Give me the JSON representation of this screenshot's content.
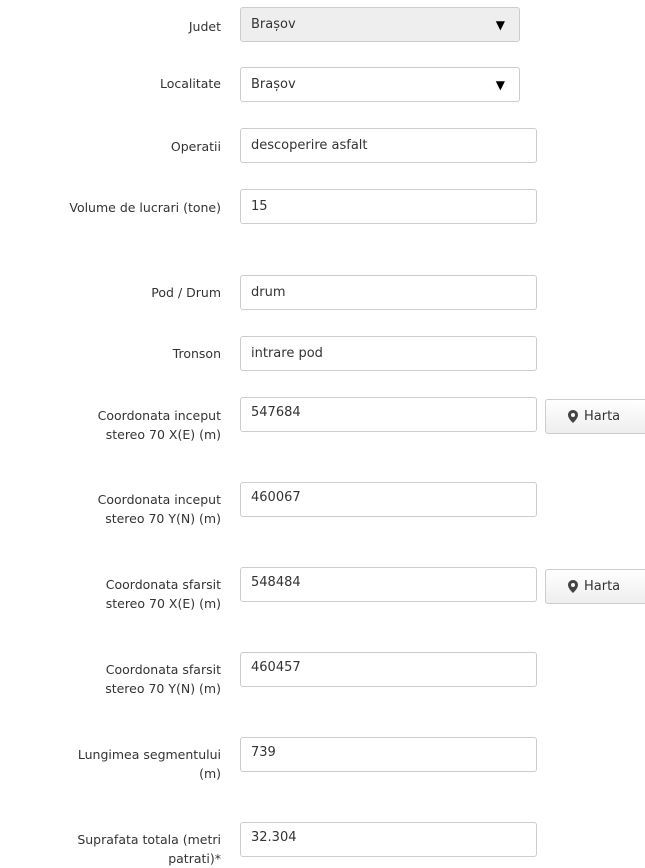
{
  "fields": {
    "judet": {
      "label": "Judet",
      "value": "Brașov"
    },
    "localitate": {
      "label": "Localitate",
      "value": "Brașov"
    },
    "operatii": {
      "label": "Operatii",
      "value": "descoperire asfalt"
    },
    "volume": {
      "label": "Volume de lucrari (tone)",
      "value": "15"
    },
    "pod_drum": {
      "label": "Pod / Drum",
      "value": "drum"
    },
    "tronson": {
      "label": "Tronson",
      "value": "intrare pod"
    },
    "inceput_x": {
      "label_line1": "Coordonata inceput",
      "label_line2": "stereo 70 X(E) (m)",
      "value": "547684"
    },
    "inceput_y": {
      "label_line1": "Coordonata inceput",
      "label_line2": "stereo 70 Y(N) (m)",
      "value": "460067"
    },
    "sfarsit_x": {
      "label_line1": "Coordonata sfarsit",
      "label_line2": "stereo 70 X(E) (m)",
      "value": "548484"
    },
    "sfarsit_y": {
      "label_line1": "Coordonata sfarsit",
      "label_line2": "stereo 70 Y(N) (m)",
      "value": "460457"
    },
    "lungime": {
      "label_line1": "Lungimea segmentului",
      "label_line2": "(m)",
      "value": "739"
    },
    "suprafata": {
      "label_line1": "Suprafata totala (metri",
      "label_line2": "patrati)*",
      "value": "32.304"
    }
  },
  "buttons": {
    "harta_label": "Harta"
  },
  "icons": {
    "dropdown": "caret-down-icon",
    "map": "map-marker-icon"
  }
}
